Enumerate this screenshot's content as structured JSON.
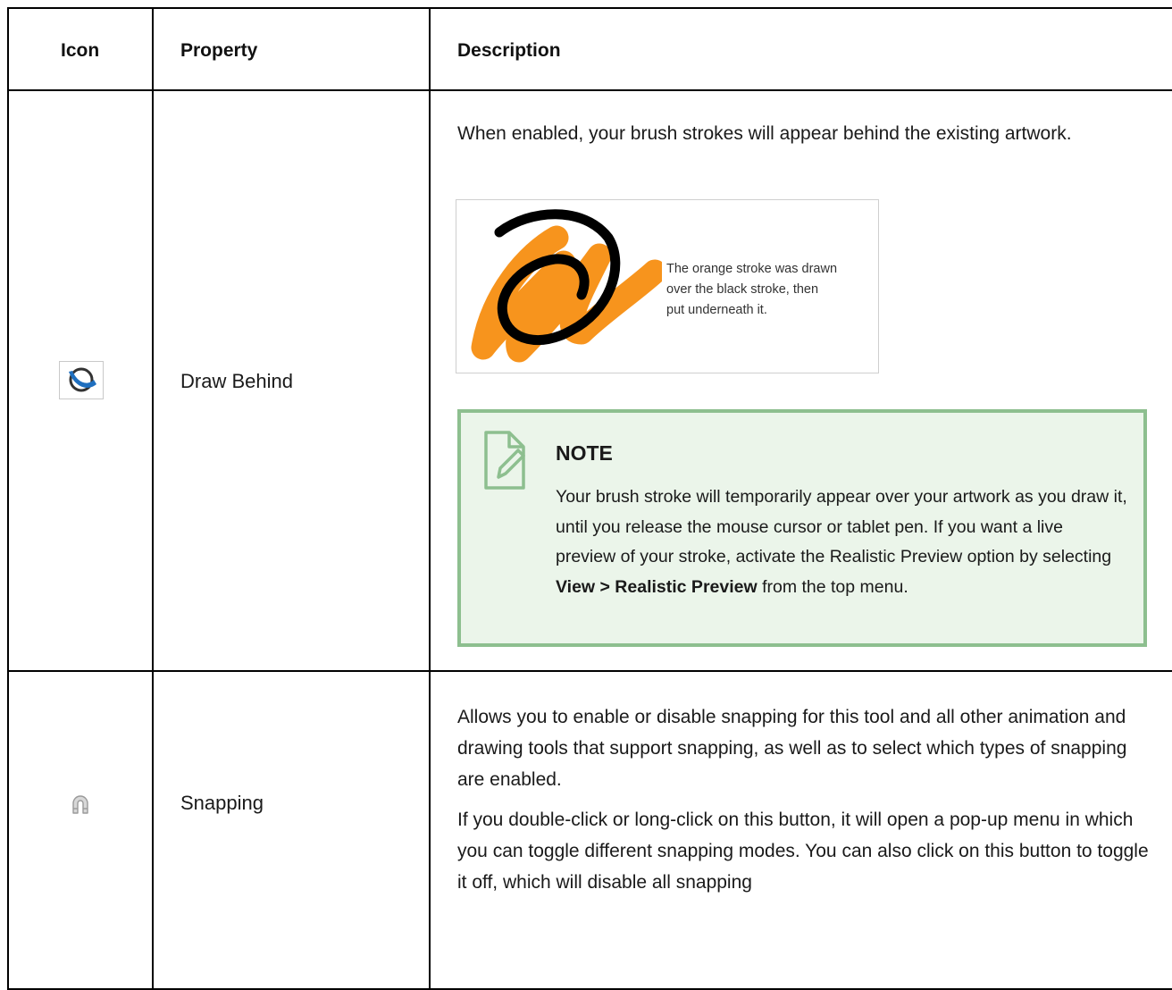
{
  "table": {
    "headers": {
      "icon": "Icon",
      "property": "Property",
      "description": "Description"
    },
    "rows": [
      {
        "icon": "draw-behind-icon",
        "property": "Draw Behind",
        "description": "When enabled, your brush strokes will appear behind the existing artwork.",
        "figure": {
          "caption_lines": [
            "The orange stroke was drawn",
            "over the black stroke, then",
            "put underneath it."
          ]
        },
        "note": {
          "title": "NOTE",
          "text_before": "Your brush stroke will temporarily appear over your artwork as you draw it, until you release the mouse cursor or tablet pen.  If you want a live preview of your stroke, activate the Realistic Preview option by selecting ",
          "bold_text": "View > Realistic Preview",
          "text_after": " from the top menu."
        }
      },
      {
        "icon": "magnet-icon",
        "property": "Snapping",
        "paragraphs": [
          "Allows you to enable or disable snapping for this tool and all other animation and drawing tools that support snapping, as well as to select which types of snapping are enabled.",
          "If you double-click or long-click on this button, it will open a pop-up menu in which you can toggle different snapping modes. You can also click on this button to toggle it off, which will disable all snapping"
        ]
      }
    ]
  },
  "colors": {
    "orange_stroke": "#F7941D",
    "note_background": "#EBF5EA",
    "note_border": "#8DBF8F",
    "icon_blue": "#1F6FBF"
  }
}
